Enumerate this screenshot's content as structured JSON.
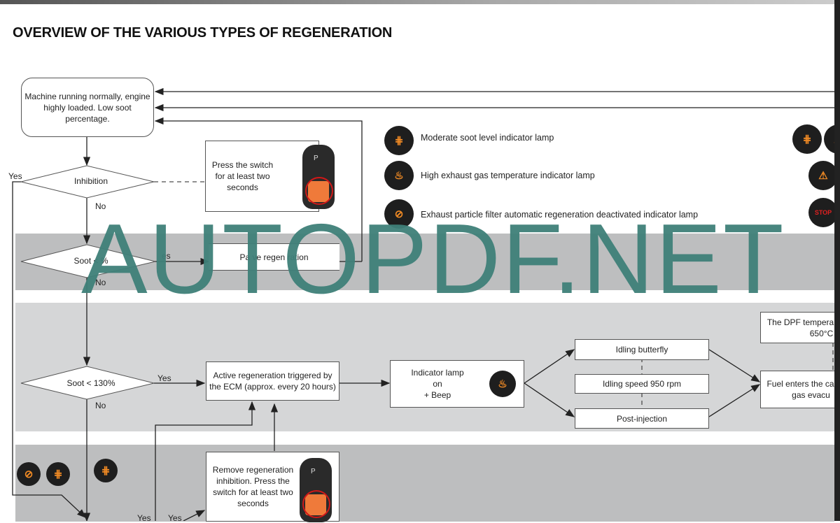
{
  "title": "OVERVIEW OF THE VARIOUS TYPES OF REGENERATION",
  "start_box": "Machine running normally, engine highly loaded. Low soot percentage.",
  "decisions": {
    "inhibition": "Inhibition",
    "soot_low": "Soot < %",
    "soot_130": "Soot < 130%"
  },
  "labels": {
    "yes": "Yes",
    "no": "No",
    "yes_partial": "es"
  },
  "boxes": {
    "press_switch": "Press the switch for at least two seconds",
    "passive": "Pa   ve regen   ration",
    "active": "Active regeneration triggered by the ECM (approx. every 20 hours)",
    "indicator_line1": "Indicator lamp",
    "indicator_line2": "on",
    "indicator_line3": "+ Beep",
    "idling_butterfly": "Idling butterfly",
    "idling_speed": "Idling speed 950 rpm",
    "post_injection": "Post-injection",
    "dpf_temp_line1": "The DPF tempera",
    "dpf_temp_line2": "650°C",
    "fuel_enters_line1": "Fuel enters the ca",
    "fuel_enters_line2": "gas evacu",
    "remove_inhibition": "Remove regeneration inhibition. Press the switch for at least two seconds"
  },
  "legend": [
    {
      "icon": "dpf-soot-icon",
      "text": "Moderate soot level indicator lamp"
    },
    {
      "icon": "exhaust-temp-icon",
      "text": "High exhaust gas temperature indicator lamp"
    },
    {
      "icon": "dpf-regen-deactivated-icon",
      "text": "Exhaust particle filter automatic regeneration deactivated indicator lamp"
    }
  ],
  "stop_label": "STOP",
  "switch_label": "P",
  "watermark": "AUTOPDF.NET",
  "colors": {
    "lamp_orange": "#f08a24",
    "stop_red": "#e02020",
    "watermark": "#3f8079",
    "band_dark": "#bdbebf",
    "band_light": "#d5d6d7"
  }
}
